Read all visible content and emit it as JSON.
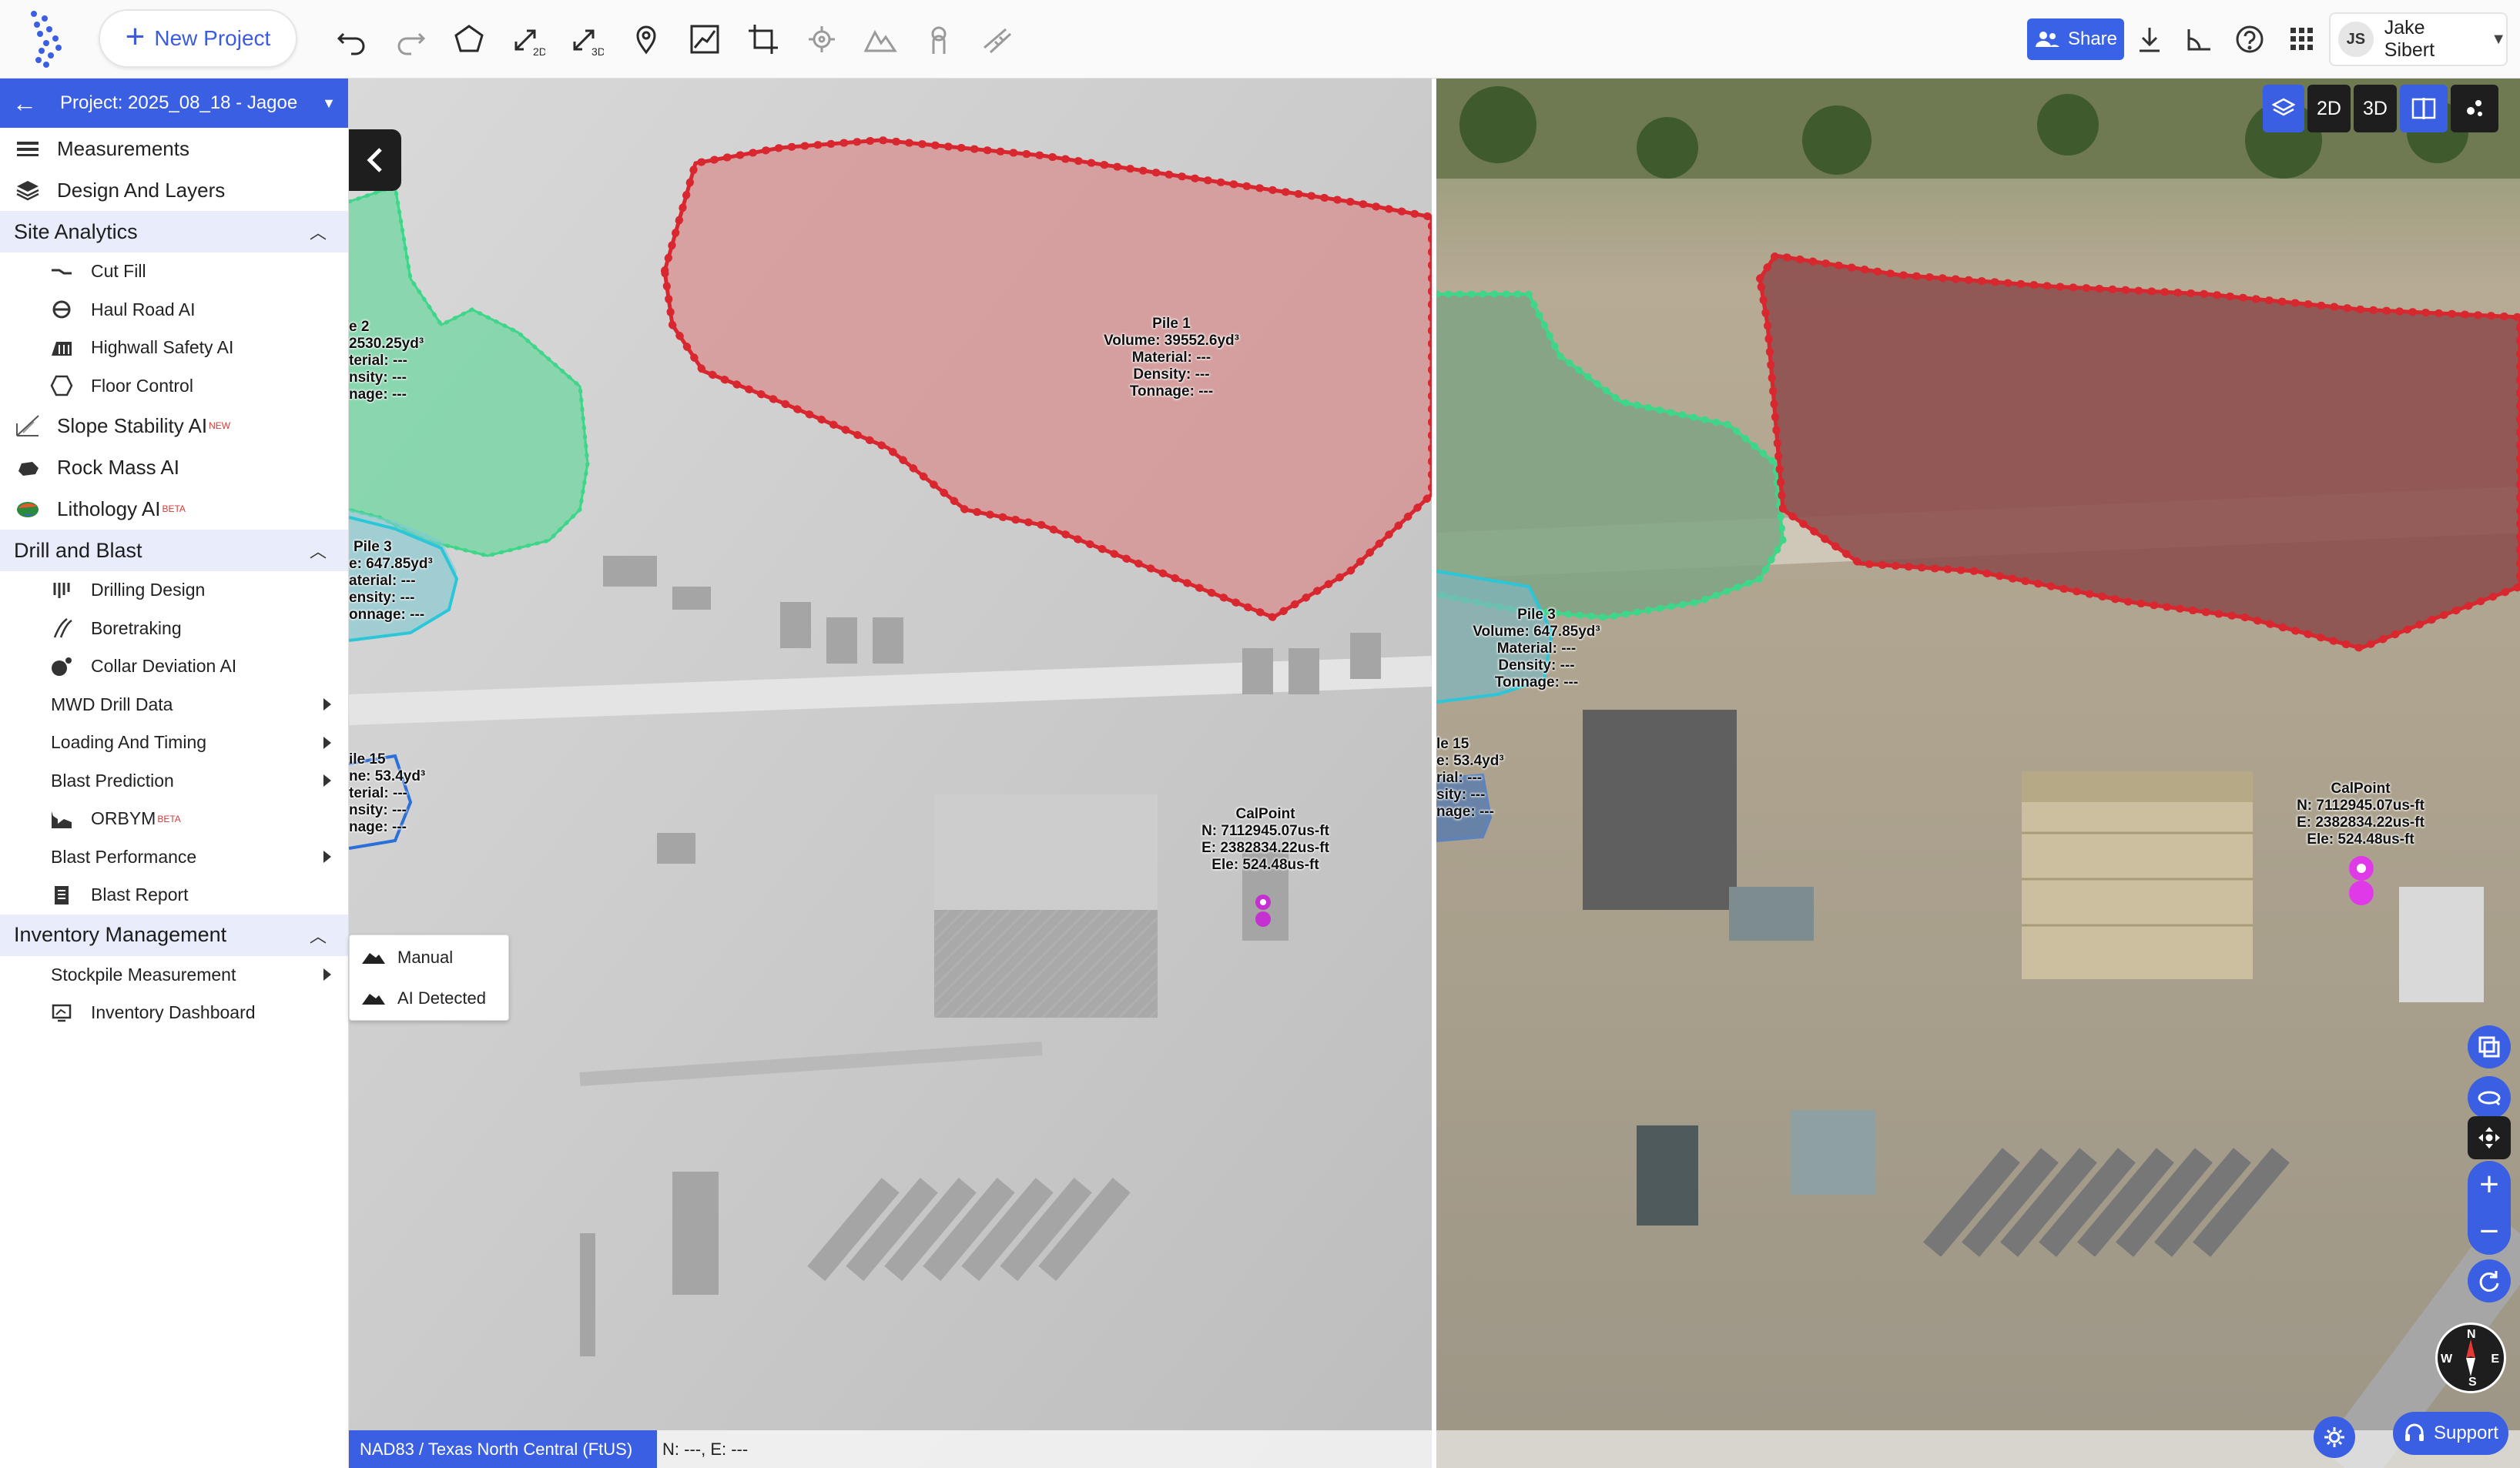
{
  "toolbar": {
    "new_project_label": "New Project",
    "share_label": "Share",
    "tools": [
      "undo-icon",
      "redo-icon",
      "polygon-icon",
      "measure-2d-icon",
      "measure-3d-icon",
      "pin-icon",
      "profile-icon",
      "crop-icon",
      "target-icon",
      "terrain-icon",
      "touch-icon",
      "ruler-icon"
    ],
    "tool_badges": {
      "d2": "2D",
      "d3": "3D"
    }
  },
  "user": {
    "initials": "JS",
    "name": "Jake Sibert"
  },
  "project": {
    "title": "Project: 2025_08_18 - Jagoe -..."
  },
  "sidebar": {
    "measurements": "Measurements",
    "design_layers": "Design And Layers",
    "site_analytics": {
      "title": "Site Analytics",
      "items": [
        "Cut Fill",
        "Haul Road AI",
        "Highwall Safety AI",
        "Floor Control"
      ]
    },
    "slope_stability": "Slope Stability AI",
    "slope_badge": "NEW",
    "rock_mass": "Rock Mass AI",
    "lithology": "Lithology AI",
    "lithology_badge": "BETA",
    "drill_blast": {
      "title": "Drill and Blast",
      "items": [
        "Drilling Design",
        "Boretraking",
        "Collar Deviation AI",
        "MWD Drill Data",
        "Loading And Timing",
        "Blast Prediction",
        "ORBYM",
        "Blast Performance",
        "Blast Report"
      ],
      "orbym_badge": "BETA"
    },
    "inventory": {
      "title": "Inventory Management",
      "items": [
        "Stockpile Measurement",
        "Inventory Dashboard"
      ]
    }
  },
  "popup": {
    "manual": "Manual",
    "ai_detected": "AI Detected"
  },
  "map": {
    "view_buttons": {
      "d2": "2D",
      "d3": "3D"
    },
    "left_labels": {
      "pile1": [
        "Pile 1",
        "Volume: 39552.6yd³",
        "Material: ---",
        "Density: ---",
        "Tonnage: ---"
      ],
      "pile2": [
        "e 2",
        "2530.25yd³",
        "terial: ---",
        "nsity: ---",
        "nage: ---"
      ],
      "pile3": [
        "Pile 3",
        "e: 647.85yd³",
        "aterial: ---",
        "ensity: ---",
        "onnage: ---"
      ],
      "pile15": [
        "ile 15",
        "ne: 53.4yd³",
        "terial: ---",
        "nsity: ---",
        "nage: ---"
      ],
      "calpoint": [
        "CalPoint",
        "N: 7112945.07us-ft",
        "E: 2382834.22us-ft",
        "Ele: 524.48us-ft"
      ]
    },
    "right_labels": {
      "pile3": [
        "Pile 3",
        "Volume: 647.85yd³",
        "Material: ---",
        "Density: ---",
        "Tonnage: ---"
      ],
      "pile15": [
        "le 15",
        "e: 53.4yd³",
        "rial: ---",
        "sity: ---",
        "nage: ---"
      ],
      "calpoint": [
        "CalPoint",
        "N: 7112945.07us-ft",
        "E: 2382834.22us-ft",
        "Ele: 524.48us-ft"
      ]
    },
    "compass": {
      "n": "N",
      "e": "E",
      "s": "S",
      "w": "W"
    },
    "crs": "NAD83 / Texas North Central (FtUS)",
    "coords": "N: ---, E: ---"
  },
  "support_label": "Support",
  "colors": {
    "accent": "#3b5fe2",
    "pile_red": "#d8272f",
    "pile_green": "#3fd68a",
    "pile_cyan": "#2bc6d8",
    "calpoint": "#c531d0"
  }
}
